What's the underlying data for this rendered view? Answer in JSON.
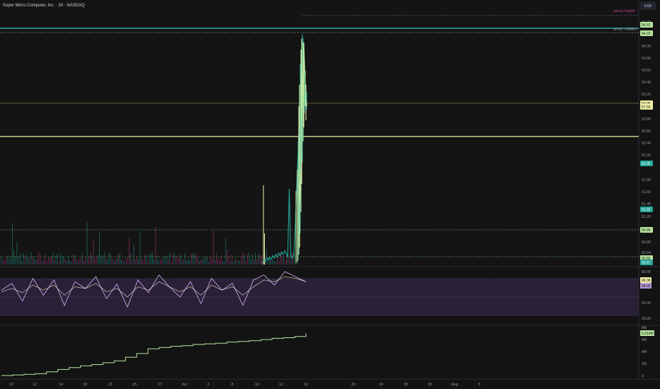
{
  "title": "Super Micro Computer, Inc. · 30 · NASDAQ",
  "currency": "USD",
  "colors": {
    "bg": "#131313",
    "cyan": "#26a69a",
    "green": "#b9e6a0",
    "yellow": "#f0f0a8",
    "pink": "#c43f8f",
    "purple": "#b59ad8",
    "orange": "#f7931a"
  },
  "annotations": {
    "sweep": "sweep maybe",
    "npoc": "nPOC - FIBBO"
  },
  "price_labels": [
    "54.40",
    "54.00",
    "53.80",
    "53.60",
    "53.40",
    "53.20",
    "52.80",
    "52.60",
    "52.40",
    "52.20",
    "51.80",
    "51.60",
    "51.40",
    "51.20",
    "50.80",
    "50.64"
  ],
  "price_tags": [
    {
      "text": "54.52",
      "bg": "#b9e6a0",
      "fg": "#131313"
    },
    {
      "text": "54.22",
      "bg": "#b9e6a0",
      "fg": "#131313"
    },
    {
      "text": "53.05",
      "bg": "#f0f0a8",
      "fg": "#131313"
    },
    {
      "text": "57.50",
      "bg": "#f0f0a8",
      "fg": "#131313"
    },
    {
      "text": "52.06",
      "bg": "#26a69a",
      "fg": "#ffffff"
    },
    {
      "text": "51.32",
      "bg": "#26a69a",
      "fg": "#ffffff"
    },
    {
      "text": "50.99",
      "bg": "#b9e6a0",
      "fg": "#131313"
    },
    {
      "text": "50.55",
      "bg": "#b9e6a0",
      "fg": "#131313"
    },
    {
      "text": "50.47",
      "bg": "#26a69a",
      "fg": "#ffffff"
    }
  ],
  "rsi_labels": [
    "80.00",
    "40.00",
    "28.00"
  ],
  "rsi_tags": [
    {
      "text": "68.38",
      "bg": "#f0f0a8",
      "fg": "#131313"
    },
    {
      "text": "58.95",
      "bg": "#b59ad8",
      "fg": "#131313"
    }
  ],
  "vol_labels": [
    "8M",
    "6M",
    "4M",
    "2M",
    "0"
  ],
  "vol_tag": {
    "text": "6.914M",
    "bg": "#b9e6a0",
    "fg": "#131313"
  },
  "x_ticks": [
    "10",
    "12",
    "14",
    "18",
    "21",
    "25",
    "27",
    "Jul",
    "3",
    "8",
    "10",
    "12",
    "16",
    "20",
    "24",
    "28",
    "30",
    "Aug",
    "5"
  ],
  "chart_data": [
    {
      "type": "line",
      "title": "Super Micro Computer, Inc. · 30 · NASDAQ",
      "ylabel": "USD",
      "yticks": [
        50.64,
        50.8,
        51.2,
        51.4,
        51.6,
        51.8,
        52.2,
        52.4,
        52.6,
        52.8,
        53.2,
        53.4,
        53.6,
        53.8,
        54.0,
        54.4
      ],
      "xticks": [
        "10",
        "12",
        "14",
        "18",
        "21",
        "25",
        "27",
        "Jul",
        "3",
        "8",
        "10",
        "12",
        "16",
        "20",
        "24",
        "28",
        "30",
        "Aug",
        "5"
      ],
      "price_levels": [
        54.52,
        54.22,
        53.05,
        52.06,
        51.32,
        50.99,
        50.55,
        50.47
      ],
      "series": [
        {
          "values": [
            50.5,
            50.55,
            50.52,
            50.58,
            50.55,
            50.6,
            50.56,
            50.62,
            50.58,
            50.64,
            50.6,
            50.66,
            50.62,
            50.68,
            50.64,
            50.7,
            50.66,
            50.6,
            51.7,
            50.62,
            50.58,
            50.64,
            51.1,
            51.8,
            52.4,
            53.2,
            53.8,
            54.15,
            53.6,
            53.1
          ]
        }
      ]
    },
    {
      "type": "line",
      "title": "",
      "yticks": [
        80.0,
        40.0,
        28.0
      ],
      "values_shown": [
        68.38,
        58.95
      ],
      "series": [
        {
          "values": [
            58,
            66,
            45,
            72,
            52,
            70,
            40,
            68,
            60,
            74,
            48,
            65,
            38,
            70,
            55,
            76,
            62,
            50,
            68,
            42,
            72,
            58,
            66,
            40,
            70,
            76,
            64,
            80,
            74,
            68
          ]
        },
        {
          "values": [
            56,
            60,
            55,
            64,
            58,
            64,
            52,
            62,
            60,
            66,
            56,
            60,
            50,
            62,
            58,
            68,
            62,
            56,
            62,
            52,
            64,
            58,
            62,
            52,
            62,
            70,
            68,
            74,
            72,
            68
          ]
        }
      ]
    },
    {
      "type": "area",
      "title": "",
      "yticks": [
        "0",
        "2M",
        "4M",
        "6M",
        "8M"
      ],
      "value_shown": "6.914M",
      "series": [
        {
          "values": [
            0,
            0.1,
            0.2,
            0.3,
            0.6,
            1.0,
            1.3,
            1.6,
            1.8,
            2.1,
            2.4,
            3.0,
            3.6,
            4.4,
            4.6,
            4.8,
            4.9,
            5.1,
            5.2,
            5.3,
            5.5,
            5.6,
            5.7,
            5.9,
            6.1,
            6.2,
            6.4,
            6.9
          ]
        }
      ]
    }
  ]
}
